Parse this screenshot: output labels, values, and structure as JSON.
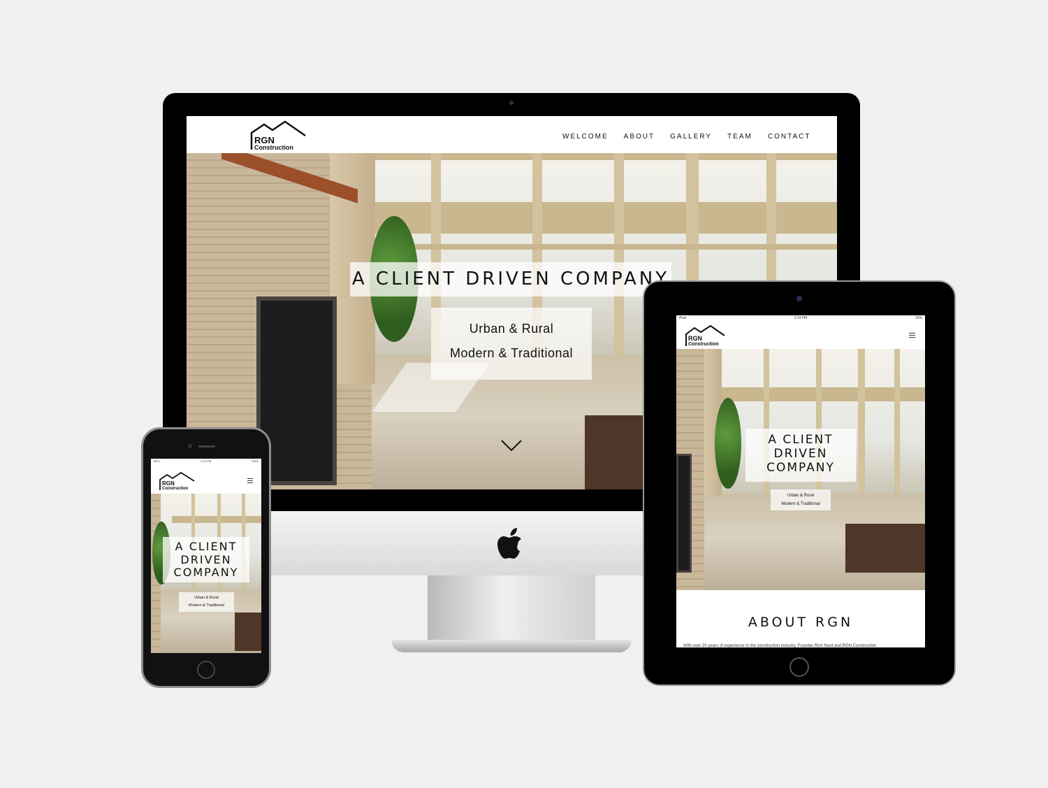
{
  "site": {
    "logo_line1": "RGN",
    "logo_line2": "Construction",
    "nav": [
      "WELCOME",
      "ABOUT",
      "GALLERY",
      "TEAM",
      "CONTACT"
    ],
    "hero_title": "A CLIENT DRIVEN COMPANY",
    "hero_title_lines": [
      "A CLIENT",
      "DRIVEN",
      "COMPANY"
    ],
    "hero_sub1": "Urban & Rural",
    "hero_sub2": "Modern & Traditional",
    "about_title": "ABOUT RGN",
    "about_text": "With over 20 years of experience in the construction industry, Founder Rich Nord and RGN Construction"
  },
  "ipad_status": {
    "carrier": "iPad",
    "time": "3:14 PM",
    "battery": "32%"
  },
  "iphone_status": {
    "carrier": "BELL",
    "time": "4:21 PM",
    "battery": "100%"
  },
  "icons": {
    "scroll_down": "chevron-down-icon",
    "menu": "hamburger-menu-icon",
    "apple": "apple-logo-icon",
    "house": "house-roof-icon"
  },
  "colors": {
    "background": "#f0f0f0",
    "device": "#000000",
    "text": "#111111"
  }
}
